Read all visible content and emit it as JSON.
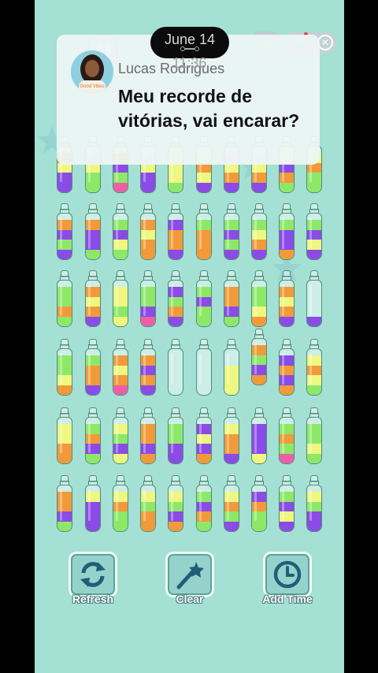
{
  "status": {
    "date": "June 14",
    "time": "11:36"
  },
  "notification": {
    "sender": "Lucas Rodrigues",
    "message": "Meu recorde de vitórias, vai encarar?",
    "avatar_shirt_text": "Good Vibes"
  },
  "top_bar": {
    "pause_icon": "pause-icon",
    "home_icon": "home-icon",
    "more_icon": "more-icon",
    "close_icon": "close-icon"
  },
  "colors": {
    "background": "#a4e0d4",
    "P": "#8a4be6",
    "O": "#f29a3a",
    "Y": "#eef77f",
    "G": "#8ee868",
    "K": "#ec5fa8",
    "L": "#cdb9f5"
  },
  "bottle_rows": [
    [
      [
        "P",
        "P",
        "Y",
        "O"
      ],
      [
        "G",
        "G",
        "Y",
        "L"
      ],
      [
        "K",
        "G",
        "P",
        "O"
      ],
      [
        "P",
        "P",
        "Y",
        "L"
      ],
      [
        "G",
        "Y",
        "Y",
        "Y"
      ],
      [
        "P",
        "Y",
        "O",
        "Y"
      ],
      [
        "P",
        "O",
        "Y",
        "L"
      ],
      [
        "P",
        "O",
        "Y",
        "L"
      ],
      [
        "G",
        "O",
        "P",
        "Y"
      ],
      [
        "G",
        "G",
        "O",
        "Y"
      ]
    ],
    [
      [
        "P",
        "G",
        "P",
        "O"
      ],
      [
        "G",
        "P",
        "P",
        "O"
      ],
      [
        "G",
        "Y",
        "P",
        "G"
      ],
      [
        "O",
        "O",
        "Y",
        "O"
      ],
      [
        "P",
        "O",
        "O",
        "P"
      ],
      [
        "O",
        "O",
        "O",
        "G"
      ],
      [
        "P",
        "G",
        "P",
        "G"
      ],
      [
        "P",
        "O",
        "Y",
        "G"
      ],
      [
        "O",
        "P",
        "P",
        "G"
      ],
      [
        "P",
        "Y",
        "P",
        "G"
      ]
    ],
    [
      [
        "G",
        "O",
        "G",
        "G"
      ],
      [
        "P",
        "O",
        "Y",
        "O"
      ],
      [
        "Y",
        "G",
        "Y",
        "Y"
      ],
      [
        "K",
        "P",
        "G",
        "G"
      ],
      [
        "P",
        "O",
        "G",
        "P"
      ],
      [
        "G",
        "G",
        "P",
        "G"
      ],
      [
        "G",
        "P",
        "O",
        "O"
      ],
      [
        "O",
        "Y",
        "G",
        "G"
      ],
      [
        "P",
        "O",
        "Y",
        "O"
      ],
      [
        "P"
      ]
    ],
    [
      [
        "O",
        "Y",
        "G",
        "G"
      ],
      [
        "P",
        "O",
        "O",
        "G"
      ],
      [
        "K",
        "O",
        "Y",
        "O"
      ],
      [
        "P",
        "O",
        "P",
        "O"
      ],
      [],
      [],
      [
        "Y",
        "Y",
        "Y"
      ],
      [
        "O",
        "P",
        "G",
        "O"
      ],
      [
        "O",
        "P",
        "O",
        "P"
      ],
      [
        "G",
        "Y",
        "O",
        "Y"
      ]
    ],
    [
      [
        "O",
        "O",
        "Y",
        "Y"
      ],
      [
        "G",
        "P",
        "O",
        "G"
      ],
      [
        "Y",
        "P",
        "G",
        "Y"
      ],
      [
        "O",
        "P",
        "O",
        "O"
      ],
      [
        "P",
        "P",
        "G",
        "G"
      ],
      [
        "O",
        "P",
        "Y",
        "P"
      ],
      [
        "P",
        "O",
        "O",
        "Y"
      ],
      [
        "Y",
        "P",
        "P",
        "P"
      ],
      [
        "K",
        "G",
        "O",
        "G"
      ],
      [
        "G",
        "Y",
        "G",
        "G"
      ]
    ],
    [
      [
        "G",
        "P",
        "O",
        "O"
      ],
      [
        "P",
        "P",
        "P",
        "Y"
      ],
      [
        "G",
        "G",
        "O",
        "Y"
      ],
      [
        "O",
        "O",
        "G",
        "Y"
      ],
      [
        "O",
        "P",
        "G",
        "Y"
      ],
      [
        "G",
        "O",
        "P",
        "G"
      ],
      [
        "P",
        "G",
        "O",
        "Y"
      ],
      [
        "G",
        "G",
        "O",
        "P"
      ],
      [
        "P",
        "Y",
        "P",
        "G"
      ],
      [
        "P",
        "P",
        "G",
        "Y"
      ]
    ]
  ],
  "tools": [
    {
      "label": "Refresh",
      "icon": "refresh-icon"
    },
    {
      "label": "Clear",
      "icon": "magic-wand-icon"
    },
    {
      "label": "Add Time",
      "icon": "clock-icon"
    }
  ]
}
